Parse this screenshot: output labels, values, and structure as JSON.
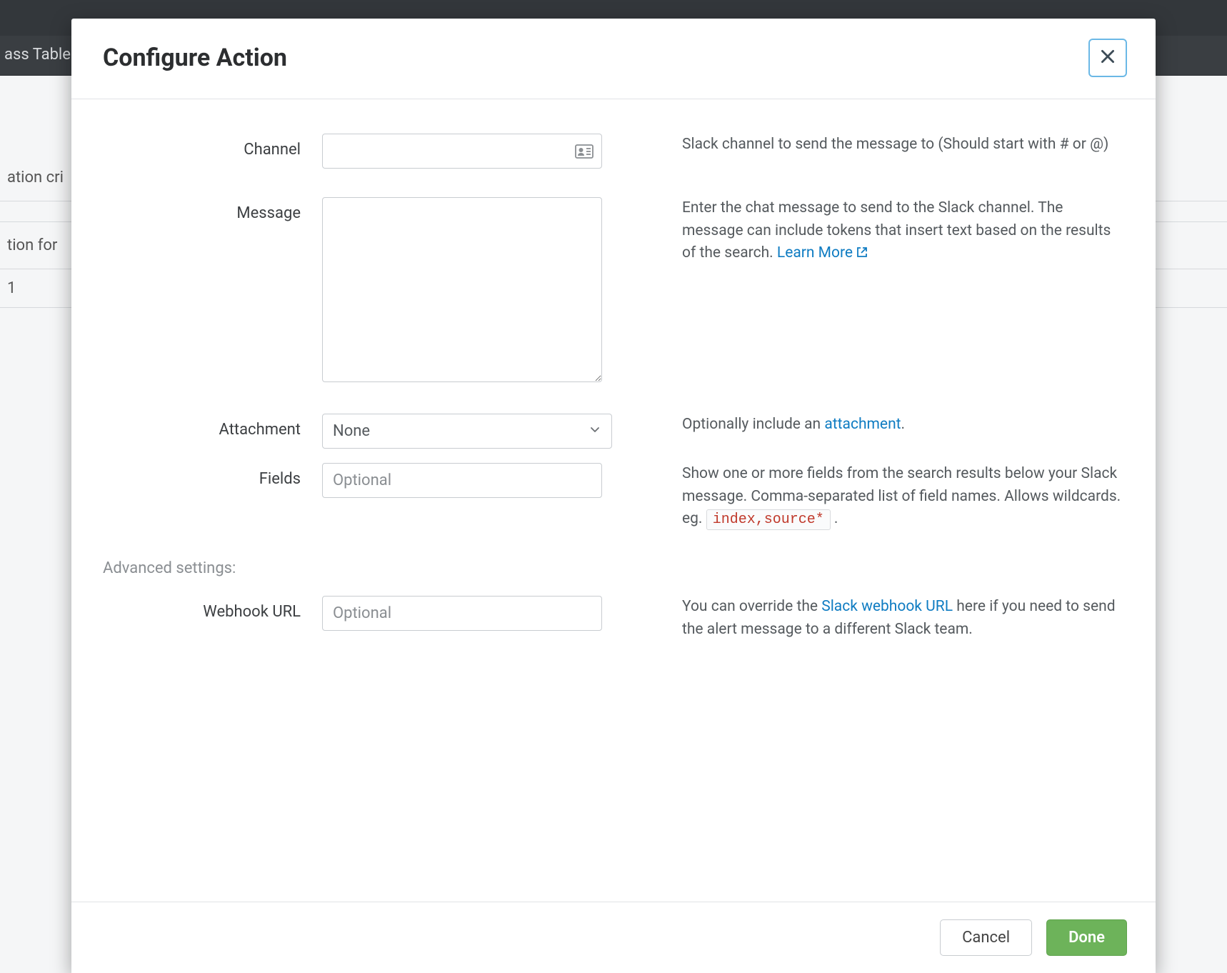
{
  "background": {
    "title_fragment_left": "ass Table",
    "row_fragment_1": "ation cri",
    "row_fragment_2": "tion for",
    "row_val": "1"
  },
  "modal": {
    "title": "Configure Action",
    "fields": {
      "channel": {
        "label": "Channel",
        "value": "",
        "help": "Slack channel to send the message to (Should start with # or @)"
      },
      "message": {
        "label": "Message",
        "value": "",
        "help_pre": "Enter the chat message to send to the Slack channel. The message can include tokens that insert text based on the results of the search. ",
        "learn_more": "Learn More"
      },
      "attachment": {
        "label": "Attachment",
        "selected": "None",
        "help_pre": "Optionally include an ",
        "help_link": "attachment",
        "help_post": "."
      },
      "fields_list": {
        "label": "Fields",
        "placeholder": "Optional",
        "value": "",
        "help_pre": "Show one or more fields from the search results below your Slack message. Comma-separated list of field names. Allows wildcards. eg. ",
        "code_example": "index,source*",
        "help_post": " ."
      }
    },
    "advanced_heading": "Advanced settings:",
    "advanced": {
      "webhook": {
        "label": "Webhook URL",
        "placeholder": "Optional",
        "value": "",
        "help_pre": "You can override the ",
        "help_link": "Slack webhook URL",
        "help_post": " here if you need to send the alert message to a different Slack team."
      }
    },
    "footer": {
      "cancel": "Cancel",
      "done": "Done"
    }
  }
}
